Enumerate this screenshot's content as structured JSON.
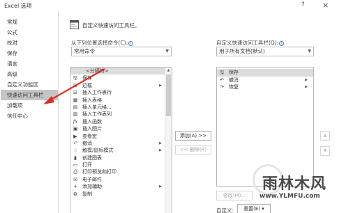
{
  "window": {
    "title": "Excel 选项",
    "help": "?",
    "close": "×"
  },
  "sidebar": {
    "items": [
      {
        "label": "常规"
      },
      {
        "label": "公式"
      },
      {
        "label": "校对"
      },
      {
        "label": "保存"
      },
      {
        "label": "语言"
      },
      {
        "label": "高级"
      },
      {
        "label": "自定义功能区"
      },
      {
        "label": "快速访问工具栏",
        "active": true
      },
      {
        "label": "加载项"
      },
      {
        "label": "信任中心"
      }
    ]
  },
  "main": {
    "header": "自定义快速访问工具栏。",
    "choose_label": "从下列位置选择命令(C):",
    "choose_value": "常用命令",
    "customize_label": "自定义快速访问工具栏(Q):",
    "customize_value": "用于所有文档(默认)",
    "commands": [
      {
        "label": "<分隔符>",
        "icon": "",
        "submenu": false
      },
      {
        "label": "保存",
        "icon": "save-icon",
        "submenu": false
      },
      {
        "label": "边框",
        "icon": "border-icon",
        "submenu": true
      },
      {
        "label": "插入工作表行",
        "icon": "insert-row-icon",
        "submenu": false
      },
      {
        "label": "插入表格",
        "icon": "table-icon",
        "submenu": false
      },
      {
        "label": "插入单元格...",
        "icon": "insert-cell-icon",
        "submenu": false
      },
      {
        "label": "插入工作表列",
        "icon": "insert-column-icon",
        "submenu": false
      },
      {
        "label": "插入函数",
        "icon": "function-icon",
        "submenu": false
      },
      {
        "label": "插入图片",
        "icon": "picture-icon",
        "submenu": false
      },
      {
        "label": "查看宏",
        "icon": "macro-icon",
        "submenu": false
      },
      {
        "label": "撤消",
        "icon": "undo-icon",
        "submenu": true
      },
      {
        "label": "触摸/鼠标模式",
        "icon": "touch-icon",
        "submenu": true
      },
      {
        "label": "创建图表",
        "icon": "chart-icon",
        "submenu": false
      },
      {
        "label": "打开",
        "icon": "open-icon",
        "submenu": false
      },
      {
        "label": "打印预览和打印",
        "icon": "print-preview-icon",
        "submenu": false
      },
      {
        "label": "电子邮件",
        "icon": "email-icon",
        "submenu": false
      },
      {
        "label": "添加辅助",
        "icon": "add-icon",
        "submenu": true
      },
      {
        "label": "复制",
        "icon": "copy-icon",
        "submenu": false
      }
    ],
    "add_button": "添加(A) >>",
    "remove_button": "<< 删除(R)",
    "toolbar_items": [
      {
        "label": "保存",
        "icon": "save-icon",
        "submenu": false
      },
      {
        "label": "撤消",
        "icon": "undo-icon",
        "submenu": true
      },
      {
        "label": "恢复",
        "icon": "redo-icon",
        "submenu": true
      }
    ],
    "move_up": "▲",
    "move_down": "▼",
    "modify_button": "修改(M)...",
    "custom_label": "自定义:",
    "reset_button": "重置(E) ▾"
  },
  "watermark": {
    "brand": "雨林木风",
    "url": "www.YLMFU.com"
  },
  "colors": {
    "active_nav": "#c5c5c5",
    "annotation_arrow": "#d93025",
    "border": "#b8b8b8"
  }
}
